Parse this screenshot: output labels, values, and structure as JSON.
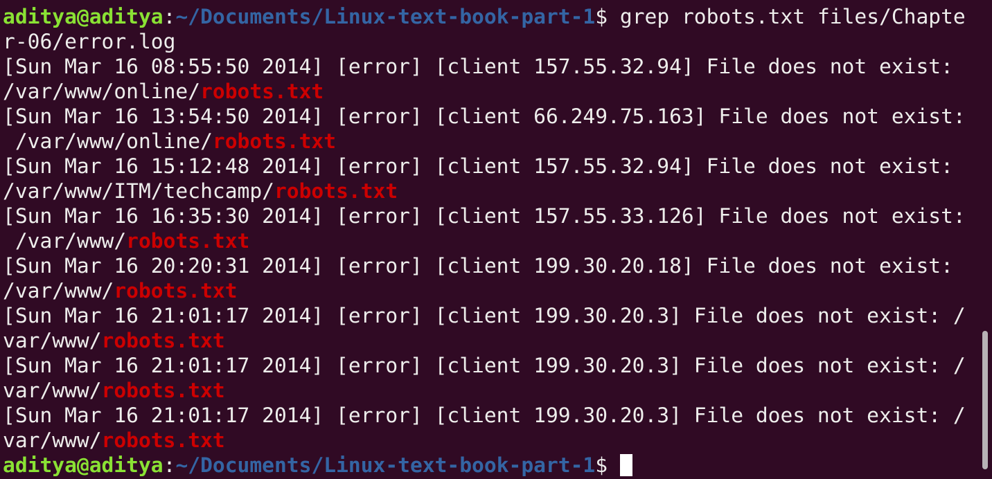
{
  "prompt": {
    "user": "aditya@aditya",
    "colon": ":",
    "path": "~/Documents/Linux-text-book-part-1",
    "symbol": "$ "
  },
  "command": {
    "first_line": "grep robots.txt files/Chapte",
    "second_line": "r-06/error.log"
  },
  "match_text": "robots.txt",
  "output_lines": [
    {
      "text": "[Sun Mar 16 08:55:50 2014] [error] [client 157.55.32.94] File does not exist: "
    },
    {
      "text": "/var/www/online/",
      "match": "robots.txt"
    },
    {
      "text": "[Sun Mar 16 13:54:50 2014] [error] [client 66.249.75.163] File does not exist:"
    },
    {
      "text": " /var/www/online/",
      "match": "robots.txt"
    },
    {
      "text": "[Sun Mar 16 15:12:48 2014] [error] [client 157.55.32.94] File does not exist: "
    },
    {
      "text": "/var/www/ITM/techcamp/",
      "match": "robots.txt"
    },
    {
      "text": "[Sun Mar 16 16:35:30 2014] [error] [client 157.55.33.126] File does not exist:"
    },
    {
      "text": " /var/www/",
      "match": "robots.txt"
    },
    {
      "text": "[Sun Mar 16 20:20:31 2014] [error] [client 199.30.20.18] File does not exist: "
    },
    {
      "text": "/var/www/",
      "match": "robots.txt"
    },
    {
      "text": "[Sun Mar 16 21:01:17 2014] [error] [client 199.30.20.3] File does not exist: /"
    },
    {
      "text": "var/www/",
      "match": "robots.txt"
    },
    {
      "text": "[Sun Mar 16 21:01:17 2014] [error] [client 199.30.20.3] File does not exist: /"
    },
    {
      "text": "var/www/",
      "match": "robots.txt"
    },
    {
      "text": "[Sun Mar 16 21:01:17 2014] [error] [client 199.30.20.3] File does not exist: /"
    },
    {
      "text": "var/www/",
      "match": "robots.txt"
    }
  ],
  "colors": {
    "background": "#300a24",
    "prompt_user": "#8ae234",
    "prompt_path": "#3465a4",
    "text": "#eeeeec",
    "match": "#cc0000"
  }
}
